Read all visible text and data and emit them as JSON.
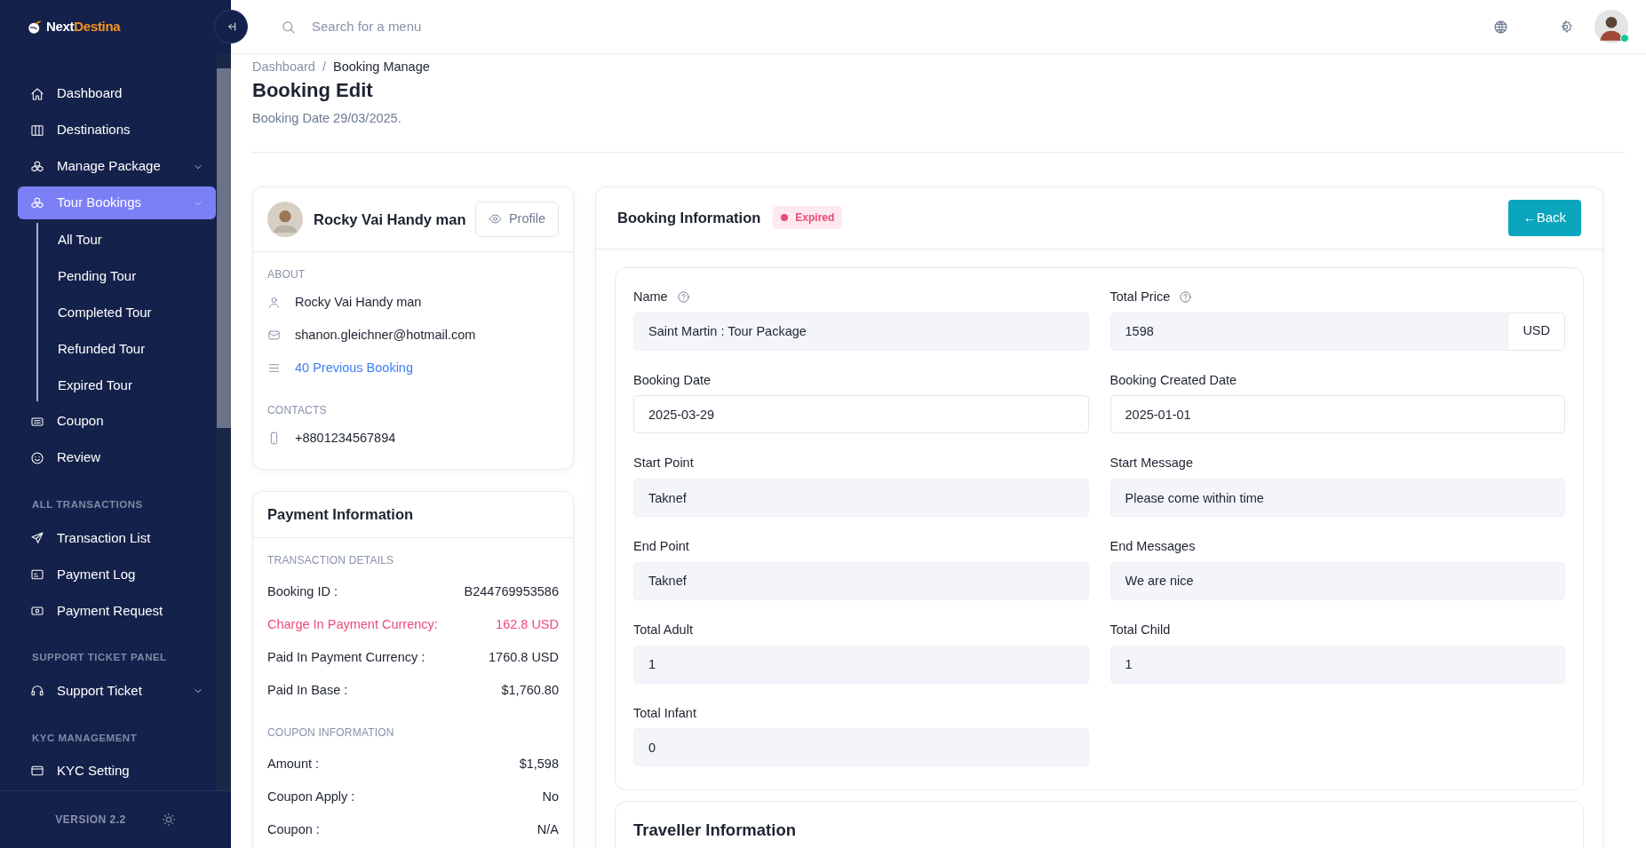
{
  "brand": {
    "primary": "Next",
    "accent": "Destina"
  },
  "sidebar": {
    "groups": [
      {
        "items": [
          {
            "label": "Dashboard",
            "selected": false,
            "submenu": false
          },
          {
            "label": "Destinations",
            "selected": false,
            "submenu": false
          },
          {
            "label": "Manage Package",
            "selected": false,
            "submenu": true
          },
          {
            "label": "Tour Bookings",
            "selected": true,
            "submenu": true,
            "children": [
              {
                "label": "All Tour",
                "selected": false
              },
              {
                "label": "Pending Tour",
                "selected": false
              },
              {
                "label": "Completed Tour",
                "selected": false
              },
              {
                "label": "Refunded Tour",
                "selected": false
              },
              {
                "label": "Expired Tour",
                "selected": false
              }
            ]
          },
          {
            "label": "Coupon",
            "selected": false,
            "submenu": false
          },
          {
            "label": "Review",
            "selected": false,
            "submenu": false
          }
        ]
      },
      {
        "heading": "ALL TRANSACTIONS",
        "items": [
          {
            "label": "Transaction List",
            "selected": false,
            "submenu": false
          },
          {
            "label": "Payment Log",
            "selected": false,
            "submenu": false
          },
          {
            "label": "Payment Request",
            "selected": false,
            "submenu": false
          }
        ]
      },
      {
        "heading": "SUPPORT TICKET PANEL",
        "items": [
          {
            "label": "Support Ticket",
            "selected": false,
            "submenu": true
          }
        ]
      },
      {
        "heading": "KYC MANAGEMENT",
        "items": [
          {
            "label": "KYC Setting",
            "selected": false,
            "submenu": false
          }
        ]
      }
    ],
    "version": "VERSION 2.2"
  },
  "topbar": {
    "search": {
      "placeholder": "Search for a menu"
    },
    "user": {
      "online": true
    }
  },
  "breadcrumb": {
    "separator": "/",
    "items": [
      {
        "label": "Dashboard"
      },
      {
        "label": "Booking Manage"
      }
    ]
  },
  "page": {
    "title": "Booking Edit",
    "subtitle": "Booking Date 29/03/2025."
  },
  "profile": {
    "name": "Rocky Vai Handy man",
    "button": "Profile",
    "about_heading": "ABOUT",
    "about": [
      {
        "kind": "person",
        "text": "Rocky Vai Handy man"
      },
      {
        "kind": "email",
        "text": "shanon.gleichner@hotmail.com"
      },
      {
        "kind": "link",
        "text": "40 Previous Booking"
      }
    ],
    "contacts_heading": "CONTACTS",
    "contacts": [
      {
        "kind": "phone",
        "text": "+8801234567894"
      }
    ]
  },
  "payment": {
    "title": "Payment Information",
    "sections": [
      {
        "heading": "TRANSACTION DETAILS",
        "rows": [
          {
            "label": "Booking ID :",
            "value": "B244769953586",
            "highlight": false
          },
          {
            "label": "Charge In Payment Currency:",
            "value": "162.8 USD",
            "highlight": true
          },
          {
            "label": "Paid In Payment Currency :",
            "value": "1760.8 USD",
            "highlight": false
          },
          {
            "label": "Paid In Base :",
            "value": "$1,760.80",
            "highlight": false
          }
        ]
      },
      {
        "heading": "COUPON INFORMATION",
        "rows": [
          {
            "label": "Amount :",
            "value": "$1,598",
            "highlight": false
          },
          {
            "label": "Coupon Apply :",
            "value": "No",
            "highlight": false
          },
          {
            "label": "Coupon :",
            "value": "N/A",
            "highlight": false
          }
        ]
      }
    ]
  },
  "booking": {
    "title": "Booking Information",
    "status": {
      "label": "Expired",
      "kind": "danger"
    },
    "back_button": "←Back",
    "fields": [
      {
        "label": "Name",
        "help": true,
        "value": "Saint Martin : Tour Package",
        "readonly": true
      },
      {
        "label": "Total Price",
        "help": true,
        "value": "1598",
        "readonly": true,
        "suffix": "USD"
      },
      {
        "label": "Booking Date",
        "help": false,
        "value": "2025-03-29",
        "readonly": false
      },
      {
        "label": "Booking Created Date",
        "help": false,
        "value": "2025-01-01",
        "readonly": false
      },
      {
        "label": "Start Point",
        "help": false,
        "value": "Taknef",
        "readonly": true
      },
      {
        "label": "Start Message",
        "help": false,
        "value": "Please come within time",
        "readonly": true
      },
      {
        "label": "End Point",
        "help": false,
        "value": "Taknef",
        "readonly": true
      },
      {
        "label": "End Messages",
        "help": false,
        "value": "We are nice",
        "readonly": true
      },
      {
        "label": "Total Adult",
        "help": false,
        "value": "1",
        "readonly": true
      },
      {
        "label": "Total Child",
        "help": false,
        "value": "1",
        "readonly": true
      },
      {
        "label": "Total Infant",
        "help": false,
        "value": "0",
        "readonly": true
      }
    ]
  },
  "traveller": {
    "title": "Traveller Information"
  }
}
